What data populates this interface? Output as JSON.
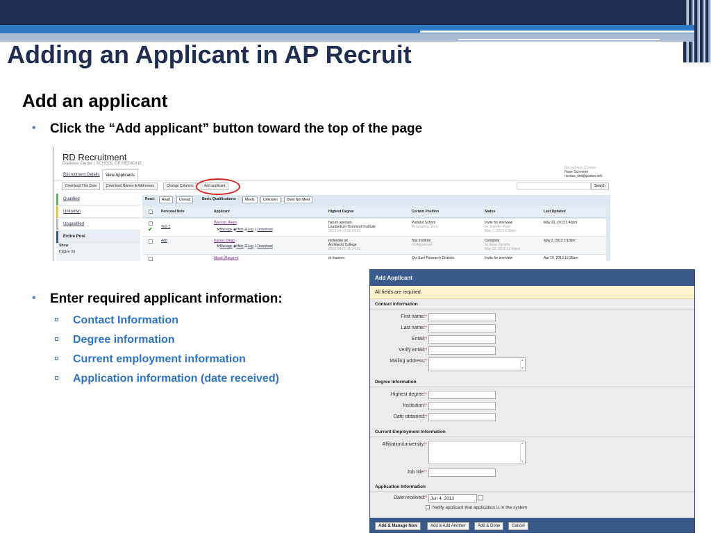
{
  "slide": {
    "title": "Adding an Applicant in AP Recruit",
    "section": "Add an applicant",
    "bullet1": "Click the “Add applicant” button toward the top of the page",
    "bullet2": "Enter required applicant information:",
    "subbullets": [
      "Contact Information",
      "Degree information",
      "Current employment information",
      "Application information (date received)"
    ]
  },
  "app": {
    "title": "RD Recruitment",
    "subtitle": "Diabetes Center | SCHOOL OF MEDICINE",
    "user": {
      "role": "Recruitment Contact",
      "name": "Hope Schmeler",
      "email": "nicolas_lind@parker.info"
    },
    "tabs": [
      "Recruitment Details",
      "View Applicants"
    ],
    "toolbar": [
      "Download This Data",
      "Download Names & Addresses",
      "Change Columns",
      "Add applicant"
    ],
    "search_label": "Search",
    "sidebar": [
      "Qualified",
      "Unknown",
      "Unqualified",
      "Entire Pool"
    ],
    "show_label": "Show",
    "hidden_label": "Hidden (0)",
    "filters": {
      "read_label": "Read:",
      "read": [
        "Read",
        "Unread"
      ],
      "basic_label": "Basic Qualifications:",
      "basic": [
        "Meets",
        "Unknown",
        "Does Not Meet"
      ]
    },
    "columns": [
      "Personal Note",
      "Applicant",
      "Highest Degree",
      "Current Position",
      "Status",
      "Last Updated"
    ],
    "actions": [
      "Manage",
      "Hide",
      "Log",
      "Download"
    ],
    "rows": [
      {
        "note": "Test 2",
        "applicant": "Wunsch, Aleen",
        "degree": "harum aperiam",
        "institution": "Laudantium Commodi Institute",
        "degree_date": "2012-04-07 11:34:33",
        "position": "Pariatur School",
        "position_sub": "Accusamus Vero",
        "status": "Invite for interview",
        "status_by": "by Jennifer Poier",
        "status_date": "May 2, 2013 3:28pm",
        "updated": "May 22, 2013 3:40pm"
      },
      {
        "note": "Add",
        "applicant": "Kunze, Diego",
        "degree": "molestiae sit",
        "institution": "Architecto College",
        "degree_date": "2012-04-07 11:34:33",
        "position": "Nisi Institute",
        "position_sub": "Ut Asperiores",
        "status": "Complete",
        "status_by": "by Rose Daniels",
        "status_date": "May 23, 2013 12:04pm",
        "updated": "May 2, 2013 3:10pm"
      },
      {
        "note": "",
        "applicant": "Mead, Margaret",
        "degree": "et maiores",
        "institution": "",
        "degree_date": "",
        "position": "Qui Sunt Research Division",
        "position_sub": "",
        "status": "Invite for interview",
        "status_by": "",
        "status_date": "",
        "updated": "Apr 10, 2013 10:35am"
      }
    ]
  },
  "dialog": {
    "title": "Add Applicant",
    "note": "All fields are required.",
    "sections": {
      "contact": "Contact Information",
      "degree": "Degree Information",
      "employment": "Current Employment Information",
      "application": "Application Information"
    },
    "labels": {
      "first_name": "First name:",
      "last_name": "Last name:",
      "email": "Email:",
      "verify_email": "Verify email:",
      "mailing_address": "Mailing address:",
      "highest_degree": "Highest degree:",
      "institution": "Institution:",
      "date_obtained": "Date obtained:",
      "affiliation": "Affiliation/university:",
      "job_title": "Job title:",
      "date_received": "Date received:"
    },
    "required_mark": "*",
    "date_received_value": "Jun 4, 2013",
    "notify_label": "Notify applicant that application is in the system",
    "buttons": [
      "Add & Manage Now",
      "Add & Add Another",
      "Add & Done",
      "Cancel"
    ]
  },
  "colors": {
    "title": "#1f2e4e",
    "accent": "#2f78c4",
    "subbullet": "#2d74c2",
    "dialog_header": "#3a5a8c",
    "highlight_ring": "#dd2222"
  }
}
